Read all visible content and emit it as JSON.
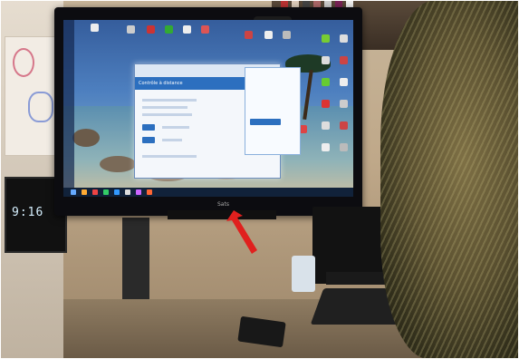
{
  "scene": {
    "clock_text": "9:16",
    "monitor_brand": "Sats",
    "window_title": "Contrôle à distance"
  },
  "colors": {
    "arrow": "#e0201e",
    "screen_accent": "#2c6fbf"
  }
}
